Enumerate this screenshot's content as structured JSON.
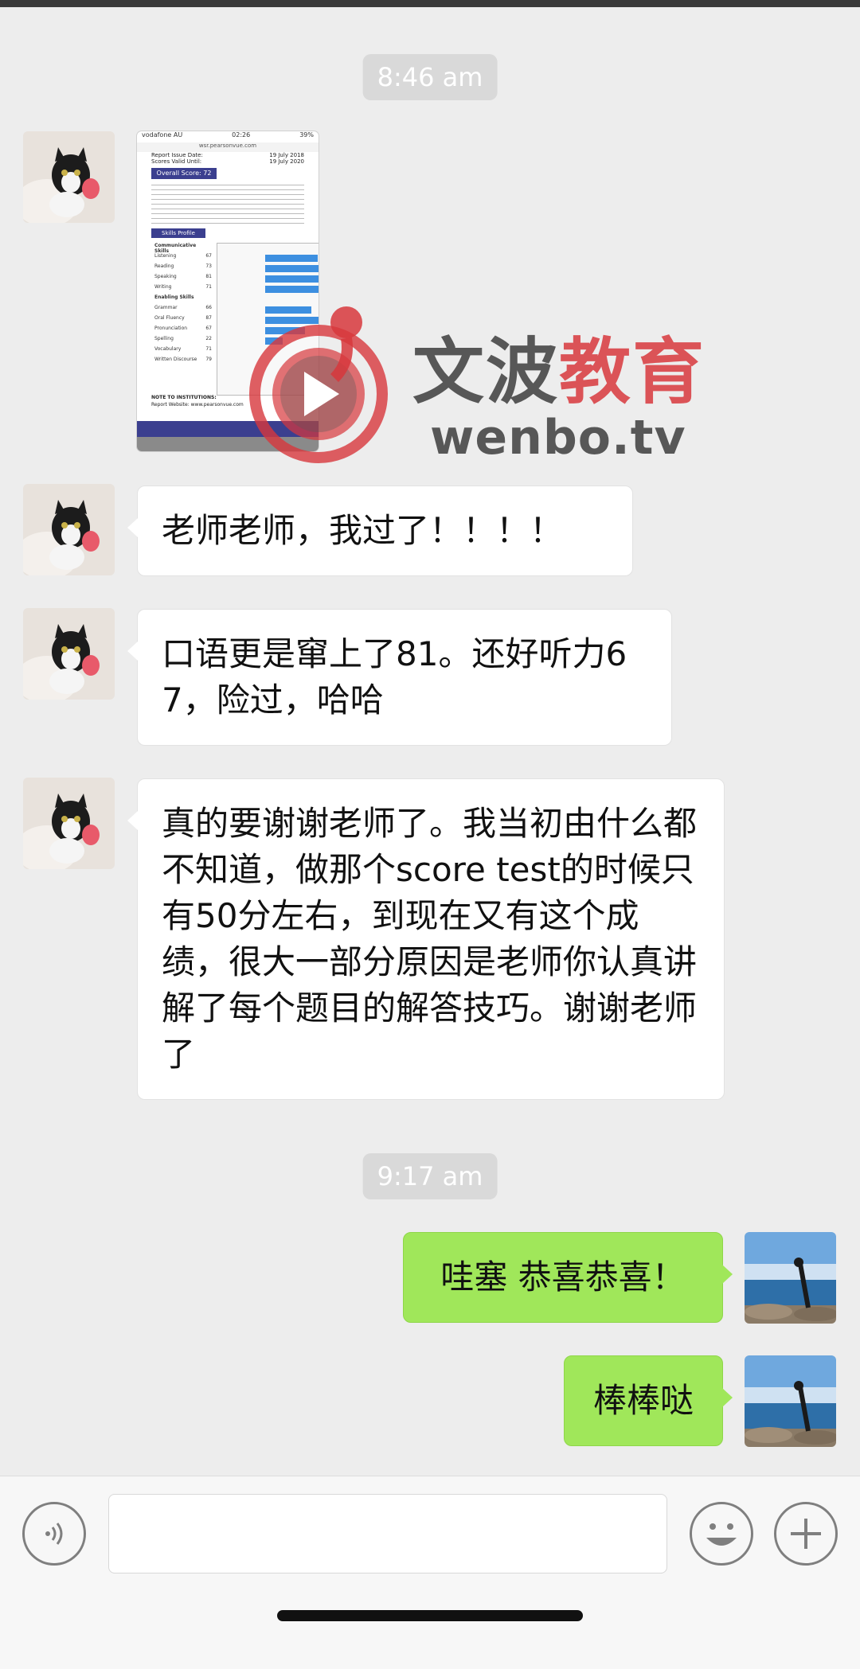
{
  "timestamps": {
    "first": "8:46 am",
    "second": "9:17 am"
  },
  "image_message": {
    "status_left": "vodafone AU",
    "status_time": "02:26",
    "status_right": "39%",
    "url": "wsr.pearsonvue.com",
    "report_issue_label": "Report Issue Date:",
    "report_issue_value": "19 July 2018",
    "valid_until_label": "Scores Valid Until:",
    "valid_until_value": "19 July 2020",
    "overall_score": "Overall Score: 72",
    "skills_profile": "Skills Profile",
    "communicative_heading": "Communicative Skills",
    "communicative": [
      {
        "label": "Listening",
        "value": "67"
      },
      {
        "label": "Reading",
        "value": "73"
      },
      {
        "label": "Speaking",
        "value": "81"
      },
      {
        "label": "Writing",
        "value": "71"
      }
    ],
    "enabling_heading": "Enabling Skills",
    "enabling": [
      {
        "label": "Grammar",
        "value": "66"
      },
      {
        "label": "Oral Fluency",
        "value": "87"
      },
      {
        "label": "Pronunciation",
        "value": "67"
      },
      {
        "label": "Spelling",
        "value": "22"
      },
      {
        "label": "Vocabulary",
        "value": "71"
      },
      {
        "label": "Written Discourse",
        "value": "79"
      }
    ],
    "note_label": "NOTE TO INSTITUTIONS:",
    "report_website": "Report Website: www.pearsonvue.com"
  },
  "watermark": {
    "cn_dark": "文波",
    "cn_red": "教育",
    "en": "wenbo.tv",
    "logo_red": "#d7373c"
  },
  "messages": {
    "m1": "老师老师，我过了！！！！",
    "m2": "口语更是窜上了81。还好听力67，险过，哈哈",
    "m3": "真的要谢谢老师了。我当初由什么都不知道，做那个score test的时候只有50分左右，到现在又有这个成绩，很大一部分原因是老师你认真讲解了每个题目的解答技巧。谢谢老师了",
    "m4": "哇塞 恭喜恭喜！",
    "m5": "棒棒哒"
  },
  "input_bar": {
    "voice_icon": "voice-icon",
    "emoji_icon": "emoji-icon",
    "plus_icon": "plus-icon",
    "text_value": ""
  },
  "colors": {
    "background": "#ededed",
    "outgoing_bubble": "#a0e75a",
    "incoming_bubble": "#ffffff"
  }
}
